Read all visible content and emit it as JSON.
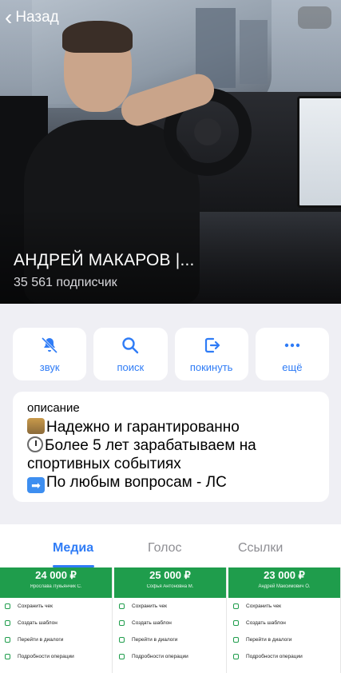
{
  "nav": {
    "back_label": "Назад"
  },
  "channel": {
    "title": "АНДРЕЙ МАКАРОВ |...",
    "subscribers": "35 561 подписчик"
  },
  "actions": [
    {
      "label": "звук",
      "icon": "bell-slash-icon"
    },
    {
      "label": "поиск",
      "icon": "search-icon"
    },
    {
      "label": "покинуть",
      "icon": "leave-icon"
    },
    {
      "label": "ещё",
      "icon": "more-icon"
    }
  ],
  "description": {
    "header": "описание",
    "lines": [
      {
        "emoji": "bank-emoji",
        "text": "Надежно и гарантированно"
      },
      {
        "emoji": "clock-emoji",
        "text": "Более 5 лет зарабатываем на"
      },
      {
        "emoji": "",
        "text": "спортивных событиях"
      },
      {
        "emoji": "arrow-emoji",
        "text": "По любым вопросам - ЛС"
      }
    ]
  },
  "tabs": [
    {
      "label": "Медиа",
      "active": true
    },
    {
      "label": "Голос",
      "active": false
    },
    {
      "label": "Ссылки",
      "active": false
    }
  ],
  "media": [
    {
      "amount": "24 000 ₽",
      "name": "Ярослава Лукьянчик С.",
      "rows": [
        "Сохранить чек",
        "Создать шаблон",
        "Перейти в диалоги",
        "Подробности операции"
      ]
    },
    {
      "amount": "25 000 ₽",
      "name": "Софья Антоновна М.",
      "rows": [
        "Сохранить чек",
        "Создать шаблон",
        "Перейти в диалоги",
        "Подробности операции"
      ]
    },
    {
      "amount": "23 000 ₽",
      "name": "Андрей Максимович О.",
      "rows": [
        "Сохранить чек",
        "Создать шаблон",
        "Перейти в диалоги",
        "Подробности операции"
      ]
    }
  ],
  "colors": {
    "accent": "#2f7cf6",
    "receipt_green": "#1f9d4c"
  }
}
